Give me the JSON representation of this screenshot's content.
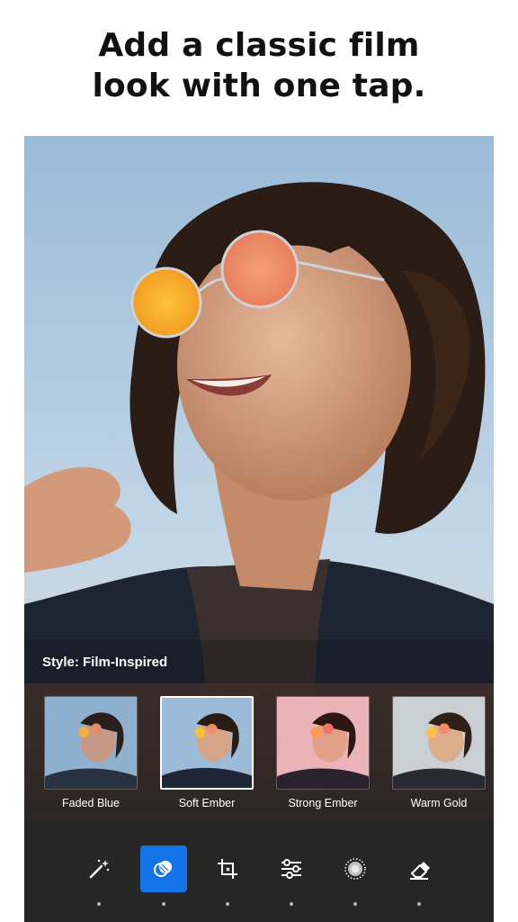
{
  "headline": {
    "line1": "Add a classic film",
    "line2": "look with one tap."
  },
  "editor": {
    "style_label": "Style: Film-Inspired",
    "presets": [
      {
        "label": "Faded Blue",
        "selected": false
      },
      {
        "label": "Soft Ember",
        "selected": true
      },
      {
        "label": "Strong Ember",
        "selected": false
      },
      {
        "label": "Warm Gold",
        "selected": false
      }
    ],
    "toolbar": {
      "tools": [
        {
          "name": "auto-fix-wand-icon",
          "active": false
        },
        {
          "name": "looks-circles-icon",
          "active": true
        },
        {
          "name": "crop-icon",
          "active": false
        },
        {
          "name": "adjust-sliders-icon",
          "active": false
        },
        {
          "name": "vignette-icon",
          "active": false
        },
        {
          "name": "eraser-icon",
          "active": false
        }
      ]
    },
    "colors": {
      "accent": "#1473e6",
      "toolbar_bg": "#262626"
    }
  }
}
